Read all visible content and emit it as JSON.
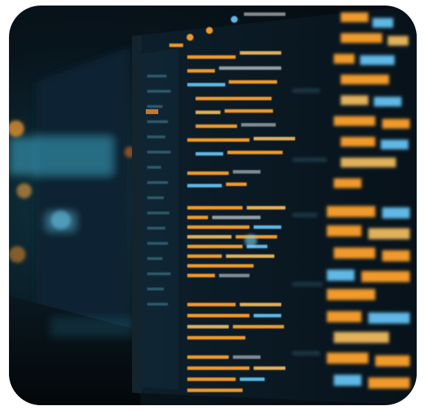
{
  "image": {
    "subject": "code-on-monitor-photo-icon",
    "accent_colors": {
      "orange": "#f19a2c",
      "amber": "#e2b15a",
      "blue": "#5fb8e6",
      "teal_glow": "#3fa9c9",
      "screen_bg": "#0b1a24"
    }
  }
}
